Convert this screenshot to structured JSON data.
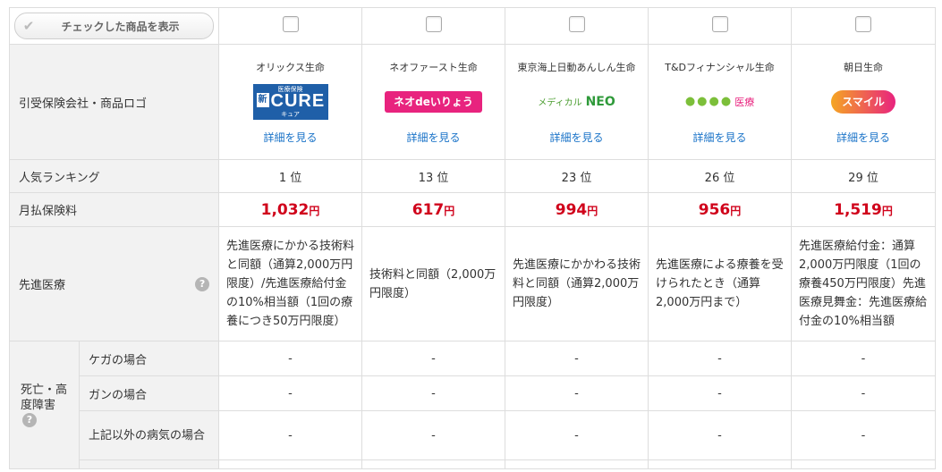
{
  "filter": {
    "label": "チェックした商品を表示",
    "check_glyph": "✔"
  },
  "rows": {
    "company_logo": "引受保険会社・商品ロゴ",
    "ranking": "人気ランキング",
    "premium": "月払保険料",
    "advanced": "先進医療",
    "death": "死亡・高度障害",
    "injury": "ケガの場合",
    "cancer": "ガンの場合",
    "other_illness": "上記以外の病気の場合"
  },
  "help_glyph": "?",
  "products": [
    {
      "company": "オリックス生命",
      "logo_text": "CURE",
      "logo_top": "医療保険",
      "logo_badge": "新",
      "logo_sub": "キュア",
      "detail": "詳細を見る",
      "rank": "1 位",
      "price": "1,032",
      "unit": "円",
      "advanced": "先進医療にかかる技術料と同額（通算2,000万円限度）/先進医療給付金の10%相当額（1回の療養につき50万円限度）",
      "injury": "-",
      "cancer": "-",
      "other": "-"
    },
    {
      "company": "ネオファースト生命",
      "logo_text": "ネオdeいりょう",
      "detail": "詳細を見る",
      "rank": "13 位",
      "price": "617",
      "unit": "円",
      "advanced": "技術料と同額（2,000万円限度）",
      "injury": "-",
      "cancer": "-",
      "other": "-"
    },
    {
      "company": "東京海上日動あんしん生命",
      "logo_text": "メディカル",
      "logo_accent": "NEO",
      "detail": "詳細を見る",
      "rank": "23 位",
      "price": "994",
      "unit": "円",
      "advanced": "先進医療にかかわる技術料と同額（通算2,000万円限度）",
      "injury": "-",
      "cancer": "-",
      "other": "-"
    },
    {
      "company": "T&Dフィナンシャル生命",
      "logo_text": "医療",
      "detail": "詳細を見る",
      "rank": "26 位",
      "price": "956",
      "unit": "円",
      "advanced": "先進医療による療養を受けられたとき（通算2,000万円まで）",
      "injury": "-",
      "cancer": "-",
      "other": "-"
    },
    {
      "company": "朝日生命",
      "logo_text": "スマイル",
      "detail": "詳細を見る",
      "rank": "29 位",
      "price": "1,519",
      "unit": "円",
      "advanced": "先進医療給付金：通算2,000万円限度（1回の療養450万円限度）先進医療見舞金：先進医療給付金の10%相当額",
      "injury": "-",
      "cancer": "-",
      "other": "-"
    }
  ],
  "colors": {
    "price_red": "#d0021b",
    "link_blue": "#1a73c8",
    "header_bg": "#f2f2f2"
  }
}
